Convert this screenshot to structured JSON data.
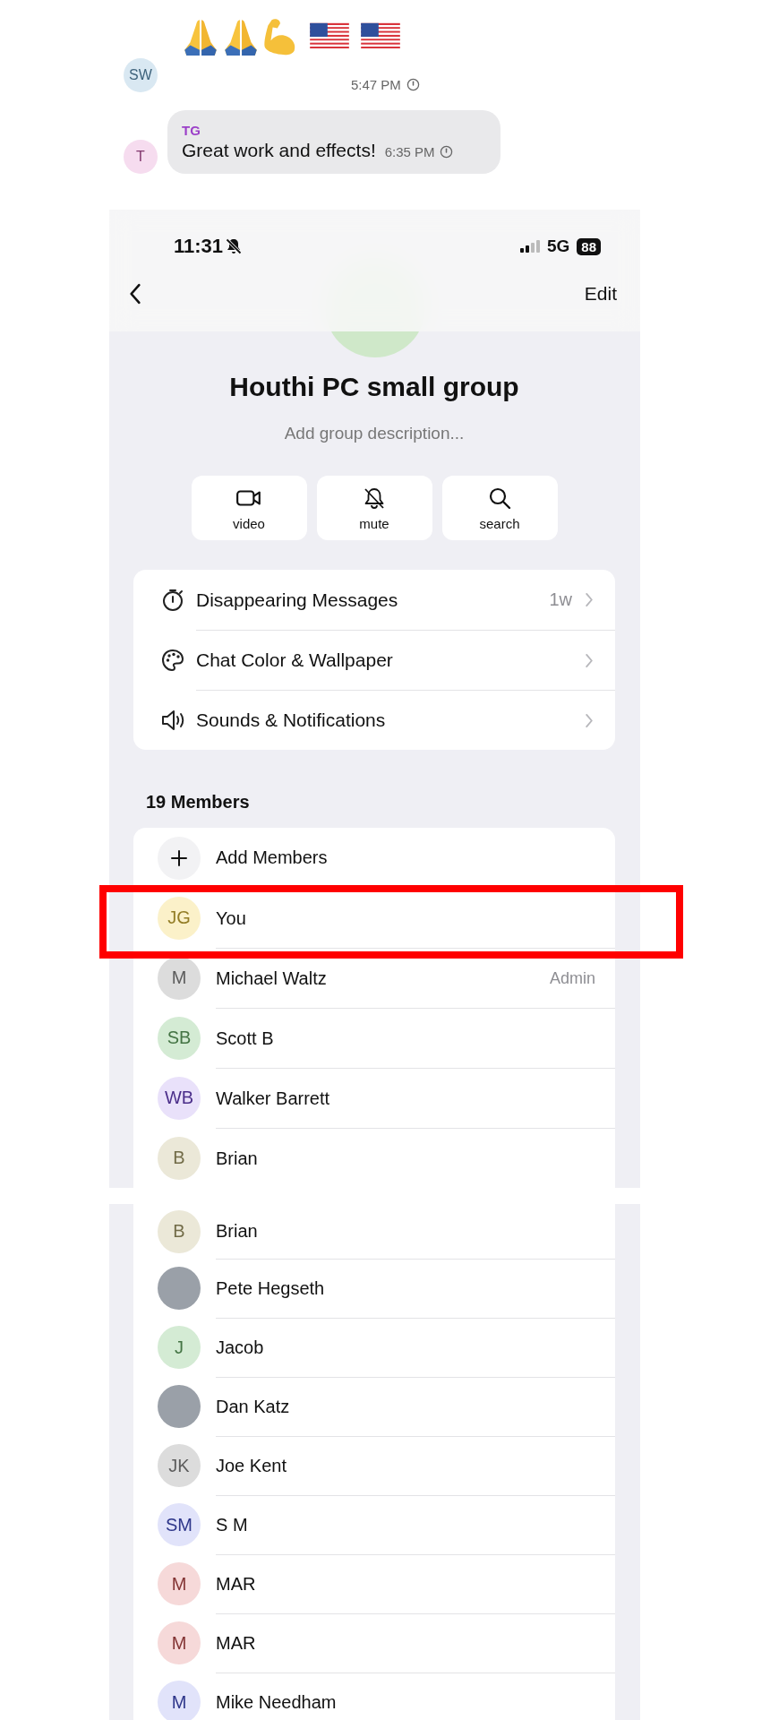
{
  "chat": {
    "messages": [
      {
        "kind": "emoji",
        "avatar": "SW",
        "color": "#d9e8f2",
        "emoji": [
          {
            "kind": "pray"
          },
          {
            "kind": "pray"
          },
          {
            "kind": "muscle"
          },
          {
            "kind": "us_flag"
          },
          {
            "kind": "us_flag"
          }
        ],
        "time": "5:47 PM"
      },
      {
        "kind": "text",
        "avatar": "T",
        "color": "#f6dcef",
        "sender": "TG",
        "text": "Great work and effects!",
        "time": "6:35 PM"
      }
    ]
  },
  "status_bar": {
    "time": "11:31",
    "network": "5G",
    "battery": "88"
  },
  "nav": {
    "action": "Edit"
  },
  "group": {
    "name": "Houthi PC small group",
    "description": "Add group description..."
  },
  "actions": [
    {
      "kind": "video",
      "label": "video"
    },
    {
      "kind": "mute",
      "label": "mute"
    },
    {
      "kind": "search",
      "label": "search"
    }
  ],
  "settings": [
    {
      "kind": "timer",
      "label": "Disappearing Messages",
      "value": "1w"
    },
    {
      "kind": "palette",
      "label": "Chat Color & Wallpaper"
    },
    {
      "kind": "sound",
      "label": "Sounds & Notifications"
    }
  ],
  "members_header": "19 Members",
  "add_members": "Add Members",
  "members": [
    {
      "kind": "initials",
      "initials": "JG",
      "name": "You",
      "color": "#fbf1c9",
      "highlighted": true
    },
    {
      "kind": "initials",
      "initials": "M",
      "name": "Michael Waltz",
      "color": "#dcdcdc",
      "role": "Admin",
      "highlighted": false
    },
    {
      "kind": "initials",
      "initials": "SB",
      "name": "Scott B",
      "color": "#d4ebd4",
      "highlighted": false
    },
    {
      "kind": "initials",
      "initials": "WB",
      "name": "Walker Barrett",
      "color": "#e9e1fa",
      "highlighted": false
    },
    {
      "kind": "initials",
      "initials": "B",
      "name": "Brian",
      "color": "#ebe8d8",
      "highlighted": false
    }
  ],
  "members_continued": [
    {
      "kind": "initials",
      "initials": "B",
      "name": "Brian",
      "color": "#ebe8d8"
    },
    {
      "kind": "photo",
      "name": "Pete Hegseth"
    },
    {
      "kind": "initials",
      "initials": "J",
      "name": "Jacob",
      "color": "#d4ebd4"
    },
    {
      "kind": "photo",
      "name": "Dan Katz"
    },
    {
      "kind": "initials",
      "initials": "JK",
      "name": "Joe Kent",
      "color": "#dcdcdc"
    },
    {
      "kind": "initials",
      "initials": "SM",
      "name": "S M",
      "color": "#e1e3fa"
    },
    {
      "kind": "initials",
      "initials": "M",
      "name": "MAR",
      "color": "#f6d9d9"
    },
    {
      "kind": "initials",
      "initials": "M",
      "name": "MAR",
      "color": "#f6d9d9"
    },
    {
      "kind": "initials",
      "initials": "M",
      "name": "Mike Needham",
      "color": "#e1e3fa"
    }
  ]
}
